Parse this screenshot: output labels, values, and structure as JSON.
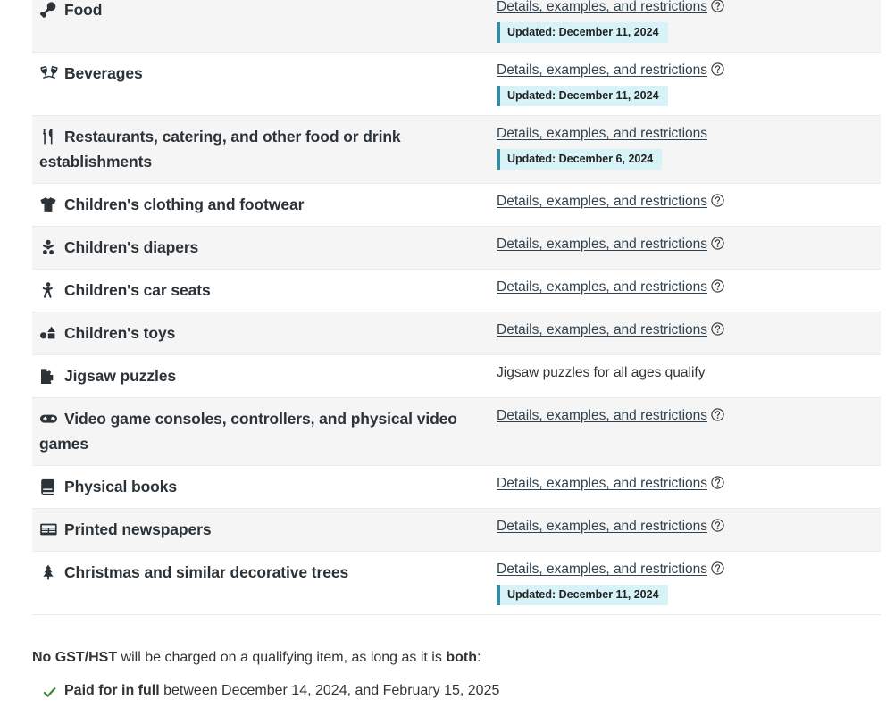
{
  "table": {
    "common": {
      "details_link_label": "Details, examples, and restrictions",
      "help_icon": "help-circle-icon"
    },
    "rows": [
      {
        "icon": "food-drumstick-icon",
        "label": "Food",
        "detail_type": "link",
        "detail_text": "Details, examples, and restrictions",
        "has_help_icon": true,
        "updated": "Updated: December 11, 2024"
      },
      {
        "icon": "beverages-cheers-icon",
        "label": "Beverages",
        "detail_type": "link",
        "detail_text": "Details, examples, and restrictions",
        "has_help_icon": true,
        "updated": "Updated: December 11, 2024"
      },
      {
        "icon": "restaurant-utensils-icon",
        "label": "Restaurants, catering, and other food or drink establishments",
        "detail_type": "link",
        "detail_text": "Details, examples, and restrictions",
        "has_help_icon": false,
        "updated": "Updated: December 6, 2024"
      },
      {
        "icon": "tshirt-icon",
        "label": "Children's clothing and footwear",
        "detail_type": "link",
        "detail_text": "Details, examples, and restrictions",
        "has_help_icon": true,
        "updated": null
      },
      {
        "icon": "baby-icon",
        "label": "Children's diapers",
        "detail_type": "link",
        "detail_text": "Details, examples, and restrictions",
        "has_help_icon": true,
        "updated": null
      },
      {
        "icon": "child-icon",
        "label": "Children's car seats",
        "detail_type": "link",
        "detail_text": "Details, examples, and restrictions",
        "has_help_icon": true,
        "updated": null
      },
      {
        "icon": "toy-shapes-icon",
        "label": "Children's toys",
        "detail_type": "link",
        "detail_text": "Details, examples, and restrictions",
        "has_help_icon": true,
        "updated": null
      },
      {
        "icon": "puzzle-piece-icon",
        "label": "Jigsaw puzzles",
        "detail_type": "text",
        "detail_text": "Jigsaw puzzles for all ages qualify",
        "has_help_icon": false,
        "updated": null
      },
      {
        "icon": "gamepad-icon",
        "label": "Video game consoles, controllers, and physical video games",
        "detail_type": "link",
        "detail_text": "Details, examples, and restrictions",
        "has_help_icon": true,
        "updated": null
      },
      {
        "icon": "book-icon",
        "label": "Physical books",
        "detail_type": "link",
        "detail_text": "Details, examples, and restrictions",
        "has_help_icon": true,
        "updated": null
      },
      {
        "icon": "newspaper-icon",
        "label": "Printed newspapers",
        "detail_type": "link",
        "detail_text": "Details, examples, and restrictions",
        "has_help_icon": true,
        "updated": null
      },
      {
        "icon": "christmas-tree-icon",
        "label": "Christmas and similar decorative trees",
        "detail_type": "link",
        "detail_text": "Details, examples, and restrictions",
        "has_help_icon": true,
        "updated": "Updated: December 11, 2024"
      }
    ]
  },
  "footnote": {
    "lead_bold": "No GST/HST",
    "middle": " will be charged on a qualifying item, as long as it is ",
    "trailing_bold": "both",
    "colon": ":",
    "bullets": [
      {
        "icon": "green-check-icon",
        "bold": "Paid for in full",
        "rest": " between December 14, 2024, and February 15, 2025"
      }
    ]
  },
  "colors": {
    "stripe": "#f5f5f5",
    "badge_bg": "#d7f3f8",
    "badge_border": "#3a8a9e",
    "link": "#30424f",
    "check_green": "#3f8a3f"
  }
}
